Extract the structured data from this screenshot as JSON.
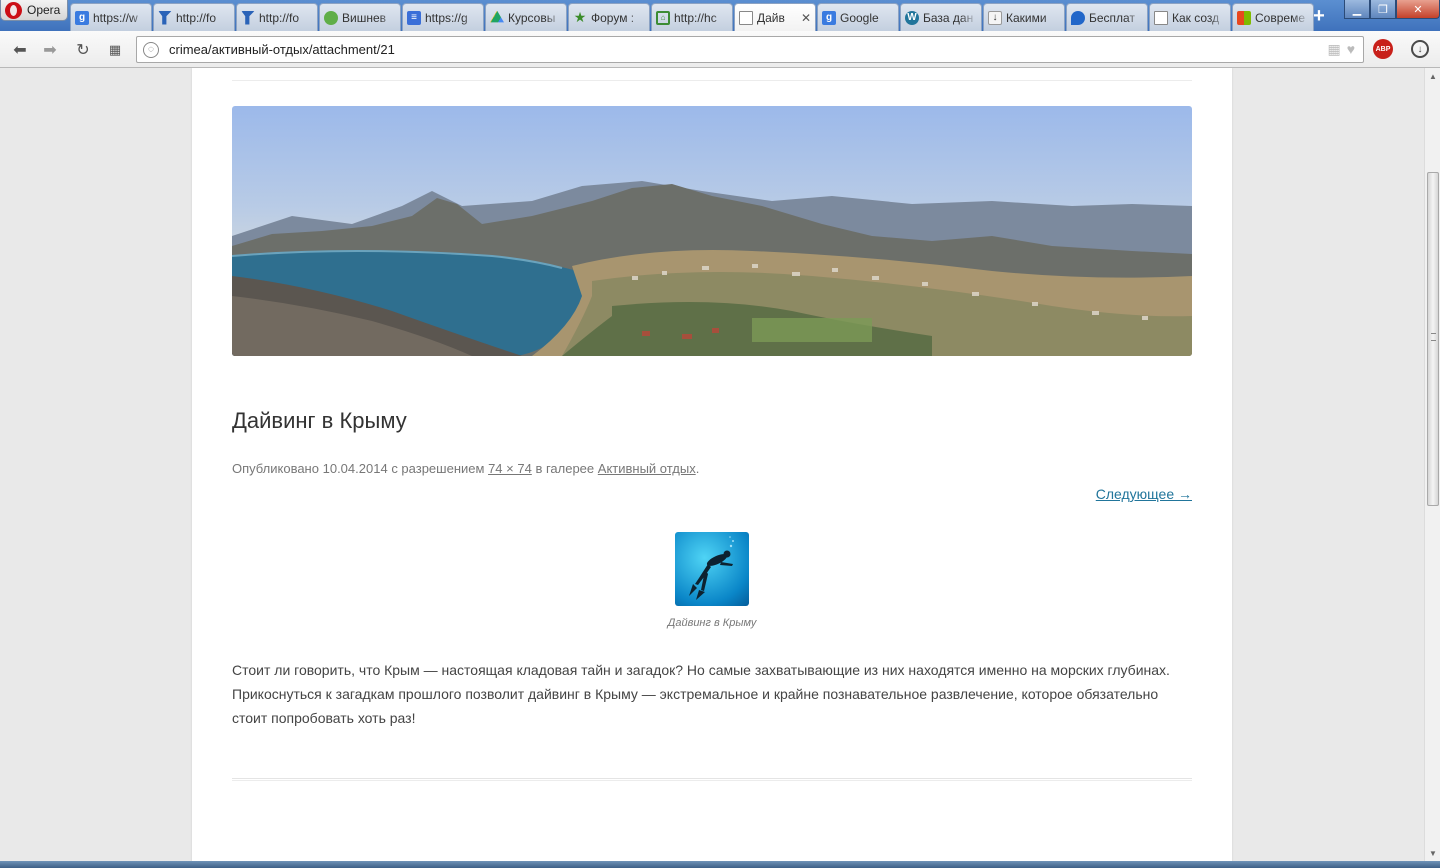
{
  "browser": {
    "menu_label": "Opera",
    "tabs": [
      {
        "label": "https://w",
        "icon": "google-icon",
        "icon_text": "g"
      },
      {
        "label": "http://fo",
        "icon": "flag-icon",
        "icon_text": ""
      },
      {
        "label": "http://fo",
        "icon": "flag-icon",
        "icon_text": ""
      },
      {
        "label": "Вишнев",
        "icon": "globe-icon",
        "icon_text": ""
      },
      {
        "label": "https://g",
        "icon": "docs-icon",
        "icon_text": "≡"
      },
      {
        "label": "Курсовы",
        "icon": "drive-icon",
        "icon_text": ""
      },
      {
        "label": "Форум :",
        "icon": "star-icon",
        "icon_text": "★"
      },
      {
        "label": "http://hc",
        "icon": "home-icon",
        "icon_text": "⌂"
      },
      {
        "label": "Дайв",
        "icon": "page-icon",
        "icon_text": "",
        "active": true
      },
      {
        "label": "Google",
        "icon": "google-icon",
        "icon_text": "g"
      },
      {
        "label": "База дан",
        "icon": "wordpress-icon",
        "icon_text": "W"
      },
      {
        "label": "Какими",
        "icon": "download-icon",
        "icon_text": "↓"
      },
      {
        "label": "Бесплат",
        "icon": "drop-icon",
        "icon_text": ""
      },
      {
        "label": "Как созд",
        "icon": "page-icon",
        "icon_text": ""
      },
      {
        "label": "Совреме",
        "icon": "windows-icon",
        "icon_text": ""
      }
    ],
    "close_tab_glyph": "✕",
    "new_tab_glyph": "+",
    "address": "crimea/активный-отдых/attachment/21",
    "adblock_label": "ABP"
  },
  "post": {
    "title": "Дайвинг в Крыму",
    "meta_prefix": "Опубликовано",
    "date": "10.04.2014",
    "meta_with": "с разрешением",
    "dimensions": "74 × 74",
    "meta_in": "в галерее",
    "gallery": "Активный отдых",
    "meta_end": ".",
    "next_link": "Следующее →",
    "caption": "Дайвинг в Крыму",
    "body": "Стоит ли говорить, что Крым — настоящая кладовая тайн и загадок? Но самые захватывающие из них находятся именно на морских глубинах. Прикоснуться к загадкам прошлого позволит дайвинг в Крыму — экстремальное и крайне познавательное развлечение, которое обязательно стоит попробовать хоть раз!"
  },
  "colors": {
    "link": "#21759b",
    "tab_bar": "#4a80c8",
    "sea": "#2f6f8f"
  }
}
